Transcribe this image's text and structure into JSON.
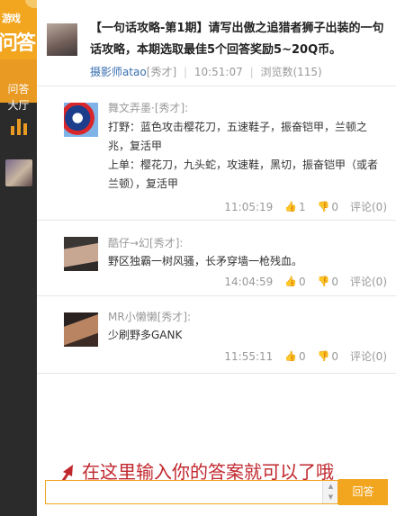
{
  "sidebar": {
    "logo_top": "游戏",
    "logo_big": "问答",
    "nav_qa_label": "问答\n大厅",
    "nav_chart_icon": "bar-chart-icon"
  },
  "question": {
    "title": "【一句话攻略-第1期】请写出傲之追猎者狮子出装的一句话攻略，本期选取最佳5个回答奖励5~20Q币。",
    "author": "摄影师atao",
    "author_tag": "[秀才]",
    "time": "10:51:07",
    "views_label": "浏览数(115)"
  },
  "answers": [
    {
      "name": "舞文弄墨·[秀才]:",
      "lines": [
        "打野：蓝色攻击樱花刀，五速鞋子，振奋铠甲，兰顿之兆，复活甲",
        "上单：樱花刀，九头蛇，攻速鞋，黑切，振奋铠甲（或者兰顿），复活甲"
      ],
      "time": "11:05:19",
      "likes": "1",
      "dislikes": "0",
      "comments": "评论(0)"
    },
    {
      "name": "酷仔→幻[秀才]:",
      "lines": [
        "野区独霸一树风骚，长矛穿墙一枪残血。"
      ],
      "time": "14:04:59",
      "likes": "0",
      "dislikes": "0",
      "comments": "评论(0)"
    },
    {
      "name": "MR小懒懒[秀才]:",
      "lines": [
        "少刷野多GANK"
      ],
      "time": "11:55:11",
      "likes": "0",
      "dislikes": "0",
      "comments": "评论(0)"
    }
  ],
  "input": {
    "value": "",
    "submit_label": "回答"
  },
  "annotation": "在这里输入你的答案就可以了哦",
  "colors": {
    "accent": "#f2a51f",
    "sidebar": "#2b2b2b",
    "author_link": "#3a6fb0",
    "annotation": "#c0272d"
  }
}
